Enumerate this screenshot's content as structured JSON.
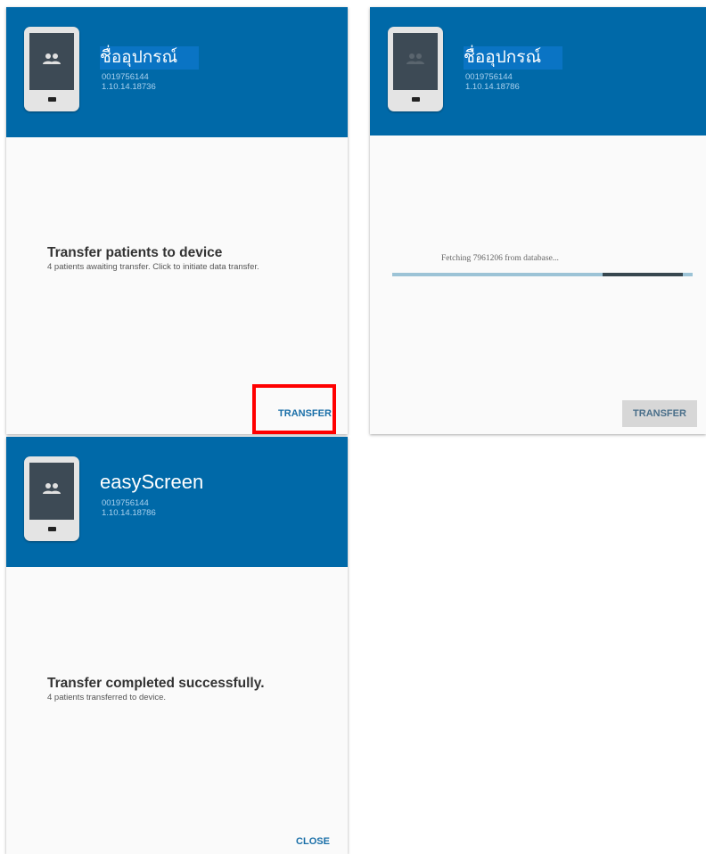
{
  "panel_a": {
    "device_name": "ชื่ออุปกรณ์",
    "serial": "0019756144",
    "version": "1.10.14.18736",
    "title": "Transfer patients to device",
    "subtitle": "4 patients awaiting transfer. Click to initiate data transfer.",
    "button": "TRANSFER"
  },
  "panel_b": {
    "device_name": "ชื่ออุปกรณ์",
    "serial": "0019756144",
    "version": "1.10.14.18786",
    "status": "Fetching 7961206 from database...",
    "progress": 0.7,
    "button": "TRANSFER"
  },
  "panel_c": {
    "device_name": "easyScreen",
    "serial": "0019756144",
    "version": "1.10.14.18786",
    "title": "Transfer completed successfully.",
    "subtitle": "4 patients transferred to device.",
    "button": "CLOSE"
  },
  "colors": {
    "header": "#0069a8",
    "highlight": "#ff0000",
    "accent": "#1a6fa8"
  },
  "icons": [
    "device-icon",
    "people-icon"
  ]
}
